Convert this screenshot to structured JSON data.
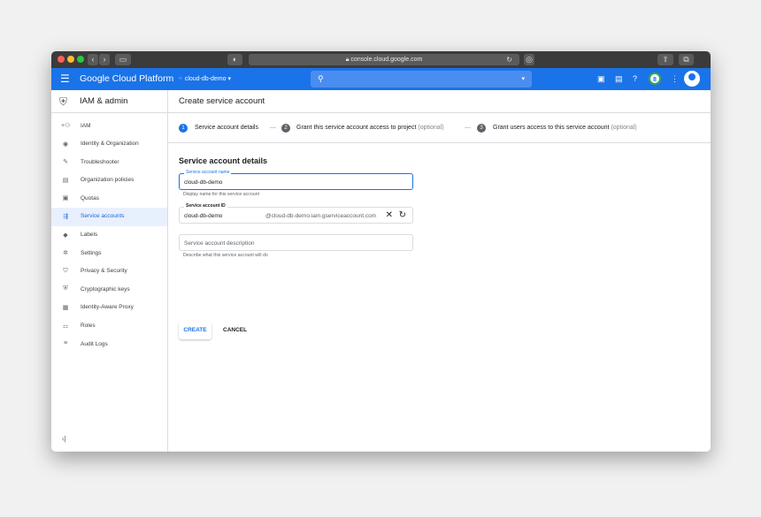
{
  "browser": {
    "url": "console.cloud.google.com",
    "back_icon": "chevron-left",
    "forward_icon": "chevron-right"
  },
  "header": {
    "brand": "Google Cloud Platform",
    "project": "cloud-db-demo",
    "notification_count": "8"
  },
  "sidebar": {
    "title": "IAM & admin",
    "items": [
      {
        "label": "IAM",
        "icon": "person-add-icon"
      },
      {
        "label": "Identity & Organization",
        "icon": "account-circle-icon"
      },
      {
        "label": "Troubleshooter",
        "icon": "wrench-icon"
      },
      {
        "label": "Organization policies",
        "icon": "policy-icon"
      },
      {
        "label": "Quotas",
        "icon": "quota-icon"
      },
      {
        "label": "Service accounts",
        "icon": "service-account-icon",
        "active": true
      },
      {
        "label": "Labels",
        "icon": "label-icon"
      },
      {
        "label": "Settings",
        "icon": "gear-icon"
      },
      {
        "label": "Privacy & Security",
        "icon": "shield-icon"
      },
      {
        "label": "Cryptographic keys",
        "icon": "key-shield-icon"
      },
      {
        "label": "Identity-Aware Proxy",
        "icon": "proxy-icon"
      },
      {
        "label": "Roles",
        "icon": "roles-icon"
      },
      {
        "label": "Audit Logs",
        "icon": "list-icon"
      }
    ],
    "collapse_icon": "collapse-icon"
  },
  "main": {
    "title": "Create service account",
    "steps": [
      {
        "num": "1",
        "label": "Service account details",
        "optional": ""
      },
      {
        "num": "2",
        "label": "Grant this service account access to project",
        "optional": "(optional)"
      },
      {
        "num": "3",
        "label": "Grant users access to this service account",
        "optional": "(optional)"
      }
    ],
    "section_title": "Service account details",
    "name_field": {
      "label": "Service account name",
      "value": "cloud-db-demo",
      "hint": "Display name for this service account"
    },
    "id_field": {
      "label": "Service account ID",
      "value": "cloud-db-demo",
      "suffix": "@cloud-db-demo.iam.gserviceaccount.com"
    },
    "description_field": {
      "placeholder": "Service account description",
      "hint": "Describe what this service account will do"
    },
    "create_label": "CREATE",
    "cancel_label": "CANCEL"
  }
}
